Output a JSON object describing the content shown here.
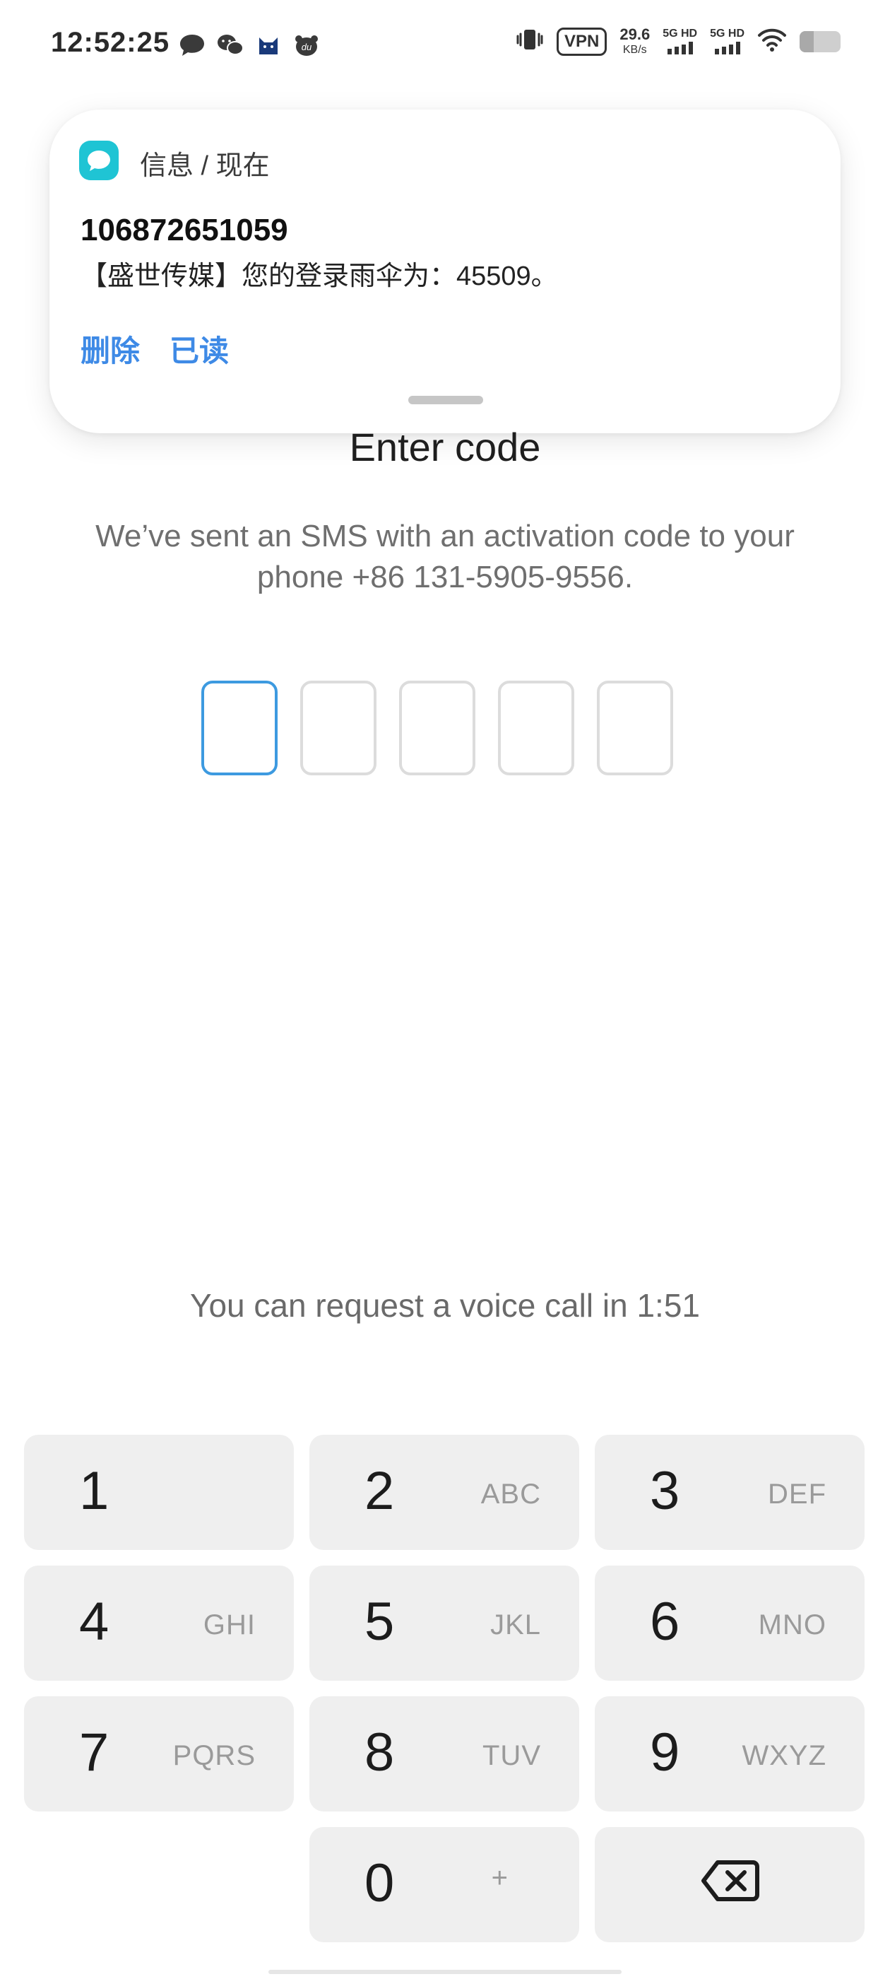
{
  "status_bar": {
    "time": "12:52:25",
    "vpn": "VPN",
    "net_speed": "29.6",
    "net_unit": "KB/s",
    "sim1": "5G HD",
    "sim2": "5G HD",
    "battery_level": 0.35
  },
  "notification": {
    "source": "信息 / 现在",
    "sender": "106872651059",
    "body": "【盛世传媒】您的登录雨伞为：45509。",
    "actions": [
      "删除",
      "已读"
    ]
  },
  "main": {
    "title": "Enter code",
    "subtitle": "We’ve sent an SMS with an activation code to your phone +86 131-5905-9556.",
    "code_length": 5,
    "voice_call_text": "You can request a voice call in 1:51"
  },
  "keypad": {
    "keys": [
      {
        "digit": "1",
        "letters": ""
      },
      {
        "digit": "2",
        "letters": "ABC"
      },
      {
        "digit": "3",
        "letters": "DEF"
      },
      {
        "digit": "4",
        "letters": "GHI"
      },
      {
        "digit": "5",
        "letters": "JKL"
      },
      {
        "digit": "6",
        "letters": "MNO"
      },
      {
        "digit": "7",
        "letters": "PQRS"
      },
      {
        "digit": "8",
        "letters": "TUV"
      },
      {
        "digit": "9",
        "letters": "WXYZ"
      },
      {
        "digit": "0",
        "letters": "+"
      }
    ],
    "backspace_icon": "backspace-icon"
  },
  "colors": {
    "accent": "#3d9ae0",
    "link": "#3e8ae6",
    "key_bg": "#efefef",
    "message_app": "#1fc4d4"
  }
}
